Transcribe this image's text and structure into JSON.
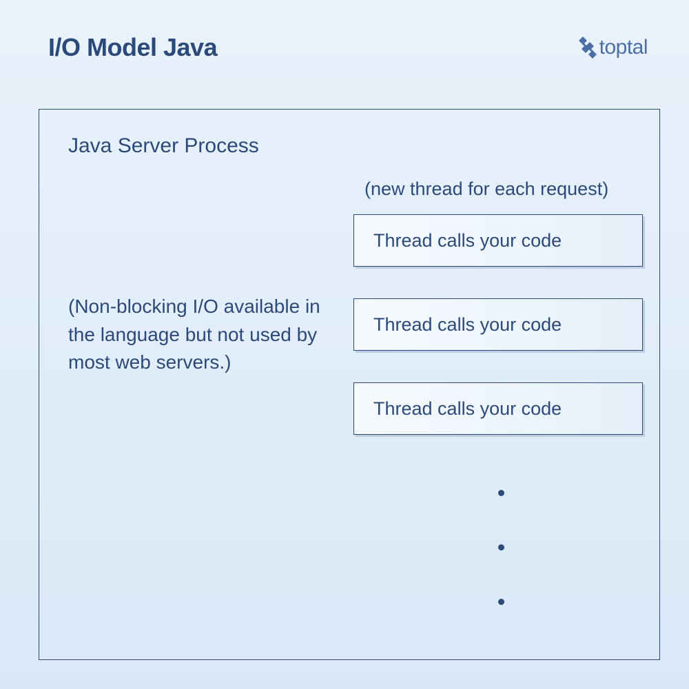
{
  "header": {
    "title": "I/O Model Java",
    "brand": "toptal"
  },
  "process": {
    "title": "Java Server Process",
    "subtitle": "(new thread for each request)",
    "note": "(Non-blocking I/O available in the language but not used by most web servers.)",
    "threads": [
      "Thread calls your code",
      "Thread calls your code",
      "Thread calls your code"
    ]
  },
  "colors": {
    "text": "#2b4a7a",
    "accent": "#4a6fa5"
  }
}
